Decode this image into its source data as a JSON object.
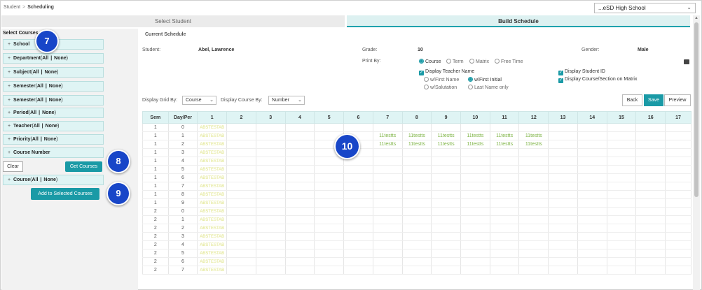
{
  "breadcrumb": {
    "parent": "Student",
    "separator": ">",
    "current": "Scheduling"
  },
  "school_select": {
    "value": "...eSD High School"
  },
  "tabs": [
    {
      "label": "Select Student",
      "active": false
    },
    {
      "label": "Build Schedule",
      "active": true
    }
  ],
  "sidebar": {
    "title": "Select Courses",
    "filters": [
      {
        "name": "School",
        "all": "",
        "none": ""
      },
      {
        "name": "Department",
        "all": "All",
        "none": "None"
      },
      {
        "name": "Subject",
        "all": "All",
        "none": "None"
      },
      {
        "name": "Semester",
        "all": "All",
        "none": "None"
      },
      {
        "name": "Semester",
        "all": "All",
        "none": "None"
      },
      {
        "name": "Period",
        "all": "All",
        "none": "None"
      },
      {
        "name": "Teacher",
        "all": "All",
        "none": "None"
      },
      {
        "name": "Priority",
        "all": "All",
        "none": "None"
      },
      {
        "name": "Course Number",
        "all": "",
        "none": ""
      }
    ],
    "clear_label": "Clear",
    "get_courses_label": "Get Courses",
    "course_filter": {
      "name": "Course",
      "all": "All",
      "none": "None"
    },
    "add_label": "Add to Selected Courses"
  },
  "badges": [
    "7",
    "8",
    "9",
    "10"
  ],
  "schedule": {
    "title": "Current Schedule",
    "student_label": "Student:",
    "student_value": "Abel, Lawrence",
    "grade_label": "Grade:",
    "grade_value": "10",
    "gender_label": "Gender:",
    "gender_value": "Male",
    "print_by_label": "Print By:",
    "print_by_options": [
      "Course",
      "Term",
      "Matrix",
      "Free Time"
    ],
    "display_teacher_label": "Display Teacher Name",
    "teacher_options": [
      "w/First Name",
      "w/First Initial",
      "w/Salutation",
      "Last Name only"
    ],
    "display_student_id_label": "Display Student ID",
    "display_course_section_label": "Display Course/Section on Matrix"
  },
  "controls": {
    "grid_by_label": "Display Grid By:",
    "grid_by_value": "Course",
    "course_by_label": "Display Course By:",
    "course_by_value": "Number",
    "back_label": "Back",
    "save_label": "Save",
    "preview_label": "Preview"
  },
  "grid": {
    "headers": [
      "Sem",
      "Day/Per",
      "1",
      "2",
      "3",
      "4",
      "5",
      "6",
      "7",
      "8",
      "9",
      "10",
      "11",
      "12",
      "13",
      "14",
      "15",
      "16",
      "17"
    ],
    "ghost_text": "ABSTESTAB",
    "course_text": "11testts",
    "rows": [
      {
        "sem": "1",
        "per": "0",
        "courses": []
      },
      {
        "sem": "1",
        "per": "1",
        "courses": [
          7,
          8,
          9,
          10,
          11,
          12
        ]
      },
      {
        "sem": "1",
        "per": "2",
        "courses": [
          7,
          8,
          9,
          10,
          11,
          12
        ]
      },
      {
        "sem": "1",
        "per": "3",
        "courses": []
      },
      {
        "sem": "1",
        "per": "4",
        "courses": []
      },
      {
        "sem": "1",
        "per": "5",
        "courses": []
      },
      {
        "sem": "1",
        "per": "6",
        "courses": []
      },
      {
        "sem": "1",
        "per": "7",
        "courses": []
      },
      {
        "sem": "1",
        "per": "8",
        "courses": []
      },
      {
        "sem": "1",
        "per": "9",
        "courses": []
      },
      {
        "sem": "2",
        "per": "0",
        "courses": []
      },
      {
        "sem": "2",
        "per": "1",
        "courses": []
      },
      {
        "sem": "2",
        "per": "2",
        "courses": []
      },
      {
        "sem": "2",
        "per": "3",
        "courses": []
      },
      {
        "sem": "2",
        "per": "4",
        "courses": []
      },
      {
        "sem": "2",
        "per": "5",
        "courses": []
      },
      {
        "sem": "2",
        "per": "6",
        "courses": []
      },
      {
        "sem": "2",
        "per": "7",
        "courses": []
      }
    ]
  },
  "colors": {
    "accent": "#1a9aa6",
    "badge": "#1846c8",
    "header_bg": "#dff4f4",
    "course_text": "#7cb342"
  }
}
